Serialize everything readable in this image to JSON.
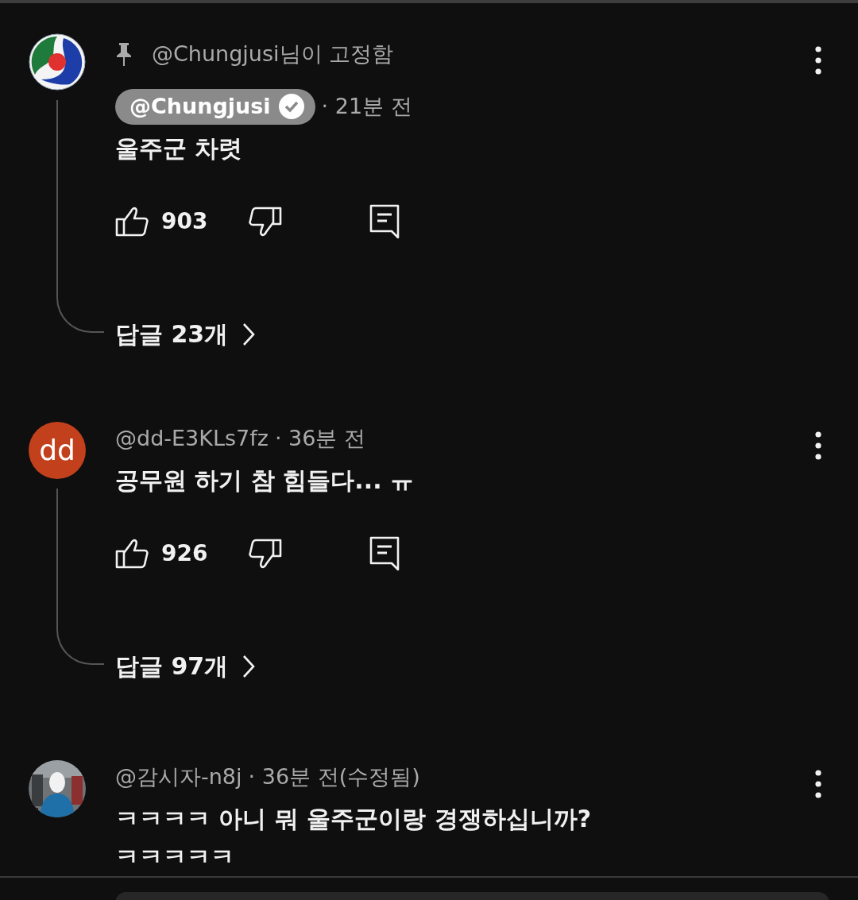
{
  "comments": [
    {
      "avatar": {
        "kind": "emblem"
      },
      "pinned_label": "@Chungjusi님이 고정함",
      "author": "@Chungjusi",
      "owner": true,
      "time": "· 21분 전",
      "lines": [
        "울주군 차렷"
      ],
      "likes": "903",
      "replies": "답글 23개"
    },
    {
      "avatar": {
        "kind": "letters",
        "text": "dd"
      },
      "author": "@dd-E3KLs7fz",
      "owner": false,
      "time": "· 36분 전",
      "lines": [
        "공무원 하기 참 힘들다... ㅠ"
      ],
      "likes": "926",
      "replies": "답글 97개"
    },
    {
      "avatar": {
        "kind": "picture"
      },
      "author": "@감시자-n8j",
      "owner": false,
      "time": "· 36분 전(수정됨)",
      "lines": [
        "ㅋㅋㅋㅋ 아니 뭐 울주군이랑 경쟁하십니까?",
        "ㅋㅋㅋㅋㅋ"
      ]
    }
  ]
}
